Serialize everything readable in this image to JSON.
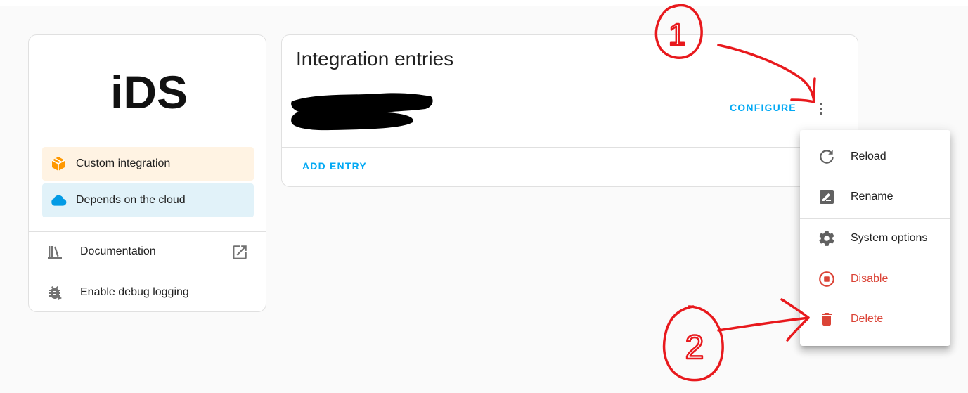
{
  "info_card": {
    "logo_text": "iDS",
    "badges": {
      "custom": "Custom integration",
      "cloud": "Depends on the cloud"
    },
    "links": {
      "documentation": "Documentation",
      "debug": "Enable debug logging"
    }
  },
  "entries": {
    "title": "Integration entries",
    "configure_label": "CONFIGURE",
    "add_entry_label": "ADD ENTRY"
  },
  "menu": {
    "items": [
      {
        "label": "Reload"
      },
      {
        "label": "Rename"
      },
      {
        "label": "System options"
      },
      {
        "label": "Disable"
      },
      {
        "label": "Delete"
      }
    ]
  },
  "colors": {
    "accent": "#03a9f4",
    "danger": "#db4437",
    "custom_badge_bg": "#fff3e3",
    "cloud_badge_bg": "#e1f2f9",
    "annotation": "#e8191d"
  },
  "annotations": {
    "step1": "1",
    "step2": "2"
  }
}
